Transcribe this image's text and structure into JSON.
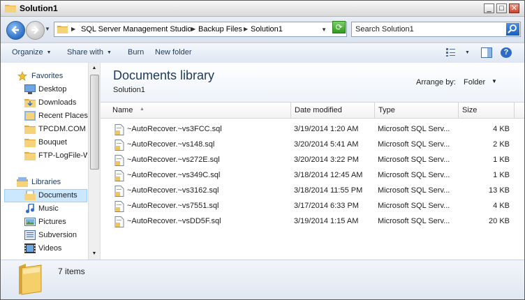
{
  "window": {
    "title": "Solution1",
    "buttons": {
      "minimize": "_",
      "maximize": "□",
      "close": "✕"
    }
  },
  "address": {
    "breadcrumbs": [
      "SQL Server Management Studio",
      "Backup Files",
      "Solution1"
    ],
    "search_placeholder": "Search Solution1"
  },
  "toolbar": {
    "organize": "Organize",
    "share_with": "Share with",
    "burn": "Burn",
    "new_folder": "New folder"
  },
  "nav": {
    "favorites_label": "Favorites",
    "favorites": [
      "Desktop",
      "Downloads",
      "Recent Places",
      "TPCDM.COM",
      "Bouquet",
      "FTP-LogFile-Wa"
    ],
    "libraries_label": "Libraries",
    "libraries": [
      "Documents",
      "Music",
      "Pictures",
      "Subversion",
      "Videos"
    ],
    "selected": "Documents"
  },
  "library": {
    "title": "Documents library",
    "subtitle": "Solution1",
    "arrange_label": "Arrange by:",
    "arrange_value": "Folder"
  },
  "table": {
    "columns": [
      "Name",
      "Date modified",
      "Type",
      "Size"
    ],
    "rows": [
      {
        "name": "~AutoRecover.~vs3FCC.sql",
        "date": "3/19/2014 1:20 AM",
        "type": "Microsoft SQL Serv...",
        "size": "4 KB"
      },
      {
        "name": "~AutoRecover.~vs148.sql",
        "date": "3/20/2014 5:41 AM",
        "type": "Microsoft SQL Serv...",
        "size": "2 KB"
      },
      {
        "name": "~AutoRecover.~vs272E.sql",
        "date": "3/20/2014 3:22 PM",
        "type": "Microsoft SQL Serv...",
        "size": "1 KB"
      },
      {
        "name": "~AutoRecover.~vs349C.sql",
        "date": "3/18/2014 12:45 AM",
        "type": "Microsoft SQL Serv...",
        "size": "1 KB"
      },
      {
        "name": "~AutoRecover.~vs3162.sql",
        "date": "3/18/2014 11:55 PM",
        "type": "Microsoft SQL Serv...",
        "size": "13 KB"
      },
      {
        "name": "~AutoRecover.~vs7551.sql",
        "date": "3/17/2014 6:33 PM",
        "type": "Microsoft SQL Serv...",
        "size": "4 KB"
      },
      {
        "name": "~AutoRecover.~vsDD5F.sql",
        "date": "3/19/2014 1:15 AM",
        "type": "Microsoft SQL Serv...",
        "size": "20 KB"
      }
    ]
  },
  "status": {
    "item_count": "7 items"
  },
  "icons": {
    "folder": "folder-icon",
    "back": "back-arrow-icon",
    "forward": "forward-arrow-icon",
    "refresh": "refresh-icon",
    "search": "search-icon",
    "file": "sql-file-icon"
  },
  "colors": {
    "accent": "#1e395b",
    "selection": "#cce8ff",
    "folder": "#f2c55c"
  }
}
